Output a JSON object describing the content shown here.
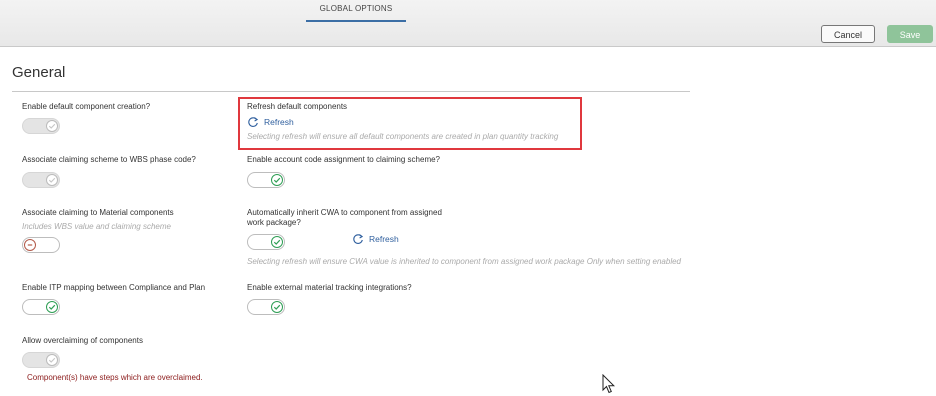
{
  "header": {
    "tab_label": "GLOBAL OPTIONS",
    "cancel_label": "Cancel",
    "save_label": "Save"
  },
  "section": {
    "title": "General"
  },
  "left_settings": [
    {
      "label": "Enable default component creation?",
      "state": "disabled"
    },
    {
      "label": "Associate claiming scheme to WBS phase code?",
      "state": "disabled"
    },
    {
      "label": "Associate claiming to Material components",
      "hint": "Includes WBS value and claiming scheme",
      "state": "off"
    },
    {
      "label": "Enable ITP mapping between Compliance and Plan",
      "state": "on"
    },
    {
      "label": "Allow overclaiming of components",
      "state": "disabled",
      "error": "Component(s) have steps which are overclaimed."
    }
  ],
  "refresh_default": {
    "label": "Refresh default components",
    "action": "Refresh",
    "hint": "Selecting refresh will ensure all default components are created in plan quantity tracking"
  },
  "right_settings": [
    {
      "label": "Enable account code assignment to claiming scheme?",
      "state": "on"
    },
    {
      "label_line1": "Automatically inherit CWA to component from assigned",
      "label_line2": "work package?",
      "state": "on",
      "action": "Refresh",
      "hint": "Selecting refresh will ensure CWA value is inherited to component from assigned work package Only when setting enabled"
    },
    {
      "label": "Enable external material tracking integrations?",
      "state": "on"
    }
  ],
  "colors": {
    "accent": "#3b6ea5",
    "save": "#8fc49a",
    "check": "#2e9e54",
    "error": "#8b1a1a",
    "highlight": "#e0383e"
  },
  "icons": [
    "refresh-icon",
    "check-icon",
    "minus-icon",
    "mouse-cursor-icon"
  ]
}
